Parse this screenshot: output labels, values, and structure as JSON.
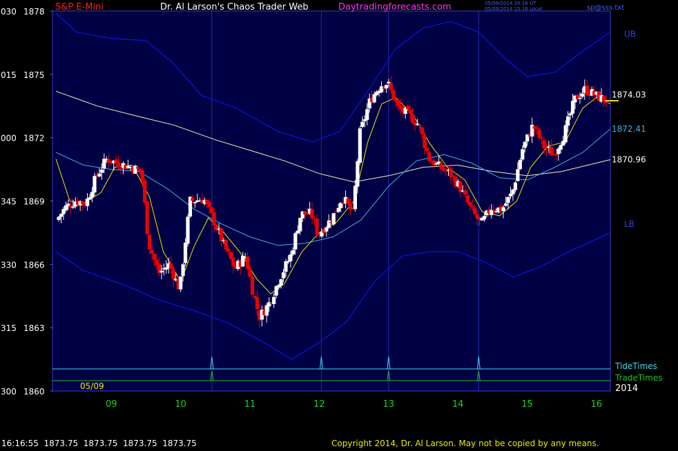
{
  "header": {
    "instrument": "S&P E-Mini",
    "author": "Dr. Al Larson's Chaos Trader Web",
    "website": "Daytradingforecasts.com",
    "utc_time": "05/09/2014 20:16 UT",
    "local_time": "05/09/2014 15:16 Local",
    "file": "sp@sss.txt"
  },
  "footer": {
    "quote": "16:16:55  1873.75  1873.75  1873.75  1873.75",
    "copyright": "Copyright 2014, Dr. Al Larson. May not be copied by any means."
  },
  "colors": {
    "background": "#000000",
    "plot_bg": "#000044",
    "up_bar": "#ffffff",
    "down_bar": "#ee0000",
    "envelope": "#0a14d6",
    "slow_ma": "#f2f2c0",
    "mid_ma": "#40b0ee",
    "fast_ma": "#f0e800",
    "tide_line": "#40d8f0",
    "trade_line": "#20c020",
    "gridline": "#1e2eb0",
    "header_red": "#ff2020",
    "header_magenta": "#ff30ff",
    "time_labels": "#20d020"
  },
  "chart_data": {
    "type": "candlestick",
    "date": "05/09",
    "year": "2014",
    "x_labels": [
      "09",
      "10",
      "11",
      "12",
      "13",
      "14",
      "15",
      "16"
    ],
    "x_range": [
      8.15,
      16.2
    ],
    "ylim": [
      1860,
      1878
    ],
    "y_ticks": [
      {
        "value": 1878,
        "label": "1878",
        "alt": "030"
      },
      {
        "value": 1875,
        "label": "1875",
        "alt": "015"
      },
      {
        "value": 1872,
        "label": "1872",
        "alt": "000"
      },
      {
        "value": 1869,
        "label": "1869",
        "alt": "345"
      },
      {
        "value": 1866,
        "label": "1866",
        "alt": "330"
      },
      {
        "value": 1863,
        "label": "1863",
        "alt": "315"
      },
      {
        "value": 1860,
        "label": "1860",
        "alt": "300"
      }
    ],
    "right_labels": [
      {
        "text": "UB",
        "value": 1876.9
      },
      {
        "text": "1874.03",
        "value": 1874.03
      },
      {
        "text": "1872.41",
        "value": 1872.41
      },
      {
        "text": "1870.96",
        "value": 1870.96
      },
      {
        "text": "LB",
        "value": 1867.9
      }
    ],
    "last_price": 1873.75,
    "vertical_lines": [
      10.45,
      12.03,
      13.0,
      14.3
    ],
    "tide_times": [
      10.45,
      12.03,
      13.0,
      14.3
    ],
    "trade_times": [
      10.45,
      13.0,
      14.3
    ],
    "legend": [
      "TideTimes",
      "TradeTimes"
    ],
    "price_path": [
      [
        8.2,
        1868.0
      ],
      [
        8.35,
        1868.7
      ],
      [
        8.5,
        1869.0
      ],
      [
        8.65,
        1868.9
      ],
      [
        8.8,
        1870.2
      ],
      [
        8.95,
        1871.0
      ],
      [
        9.1,
        1870.8
      ],
      [
        9.3,
        1870.6
      ],
      [
        9.45,
        1870.4
      ],
      [
        9.55,
        1867.0
      ],
      [
        9.7,
        1865.6
      ],
      [
        9.85,
        1866.0
      ],
      [
        10.0,
        1864.8
      ],
      [
        10.15,
        1869.0
      ],
      [
        10.35,
        1869.1
      ],
      [
        10.5,
        1868.0
      ],
      [
        10.65,
        1866.8
      ],
      [
        10.8,
        1865.8
      ],
      [
        10.95,
        1866.4
      ],
      [
        11.05,
        1864.8
      ],
      [
        11.15,
        1863.5
      ],
      [
        11.3,
        1864.2
      ],
      [
        11.45,
        1865.4
      ],
      [
        11.6,
        1866.4
      ],
      [
        11.75,
        1868.4
      ],
      [
        11.9,
        1868.4
      ],
      [
        12.0,
        1867.4
      ],
      [
        12.2,
        1868.2
      ],
      [
        12.35,
        1869.2
      ],
      [
        12.5,
        1868.4
      ],
      [
        12.6,
        1872.2
      ],
      [
        12.75,
        1873.8
      ],
      [
        12.9,
        1874.5
      ],
      [
        13.0,
        1874.6
      ],
      [
        13.15,
        1873.4
      ],
      [
        13.3,
        1873.1
      ],
      [
        13.45,
        1872.6
      ],
      [
        13.6,
        1871.0
      ],
      [
        13.75,
        1870.6
      ],
      [
        13.9,
        1870.3
      ],
      [
        14.05,
        1869.6
      ],
      [
        14.2,
        1868.6
      ],
      [
        14.35,
        1867.9
      ],
      [
        14.5,
        1868.7
      ],
      [
        14.65,
        1868.6
      ],
      [
        14.8,
        1869.4
      ],
      [
        14.95,
        1871.5
      ],
      [
        15.1,
        1872.6
      ],
      [
        15.25,
        1871.6
      ],
      [
        15.4,
        1871.2
      ],
      [
        15.55,
        1872.2
      ],
      [
        15.7,
        1873.8
      ],
      [
        15.85,
        1874.3
      ],
      [
        16.0,
        1874.0
      ],
      [
        16.15,
        1873.75
      ]
    ],
    "upper_band": [
      [
        8.2,
        1877.9
      ],
      [
        8.5,
        1877.0
      ],
      [
        9.0,
        1876.7
      ],
      [
        9.5,
        1876.6
      ],
      [
        9.9,
        1875.5
      ],
      [
        10.3,
        1874.0
      ],
      [
        10.8,
        1873.4
      ],
      [
        11.4,
        1872.3
      ],
      [
        11.9,
        1871.8
      ],
      [
        12.3,
        1872.3
      ],
      [
        12.7,
        1874.2
      ],
      [
        13.1,
        1876.2
      ],
      [
        13.5,
        1877.2
      ],
      [
        13.9,
        1877.5
      ],
      [
        14.3,
        1877.0
      ],
      [
        14.7,
        1875.7
      ],
      [
        15.0,
        1874.9
      ],
      [
        15.4,
        1875.1
      ],
      [
        15.8,
        1876.1
      ],
      [
        16.2,
        1877.0
      ]
    ],
    "lower_band": [
      [
        8.2,
        1866.6
      ],
      [
        8.6,
        1865.7
      ],
      [
        9.2,
        1865.0
      ],
      [
        9.7,
        1864.3
      ],
      [
        10.2,
        1863.8
      ],
      [
        10.7,
        1863.2
      ],
      [
        11.2,
        1862.3
      ],
      [
        11.6,
        1861.5
      ],
      [
        12.0,
        1862.3
      ],
      [
        12.4,
        1863.3
      ],
      [
        12.8,
        1865.2
      ],
      [
        13.2,
        1866.4
      ],
      [
        13.6,
        1866.6
      ],
      [
        14.0,
        1866.6
      ],
      [
        14.4,
        1866.1
      ],
      [
        14.8,
        1865.4
      ],
      [
        15.2,
        1865.9
      ],
      [
        15.6,
        1866.6
      ],
      [
        16.2,
        1867.5
      ]
    ],
    "slow_ma": [
      [
        8.2,
        1874.2
      ],
      [
        8.8,
        1873.5
      ],
      [
        9.4,
        1873.0
      ],
      [
        9.9,
        1872.6
      ],
      [
        10.5,
        1871.9
      ],
      [
        11.0,
        1871.4
      ],
      [
        11.5,
        1870.9
      ],
      [
        12.0,
        1870.3
      ],
      [
        12.5,
        1869.9
      ],
      [
        13.0,
        1870.2
      ],
      [
        13.5,
        1870.6
      ],
      [
        14.0,
        1870.7
      ],
      [
        14.5,
        1870.4
      ],
      [
        15.0,
        1870.2
      ],
      [
        15.5,
        1870.4
      ],
      [
        16.2,
        1870.96
      ]
    ],
    "mid_ma": [
      [
        8.2,
        1871.3
      ],
      [
        8.6,
        1870.7
      ],
      [
        9.0,
        1870.5
      ],
      [
        9.4,
        1870.4
      ],
      [
        9.8,
        1869.6
      ],
      [
        10.2,
        1868.6
      ],
      [
        10.6,
        1867.9
      ],
      [
        11.0,
        1867.3
      ],
      [
        11.4,
        1866.9
      ],
      [
        11.8,
        1867.0
      ],
      [
        12.2,
        1867.3
      ],
      [
        12.6,
        1868.1
      ],
      [
        13.0,
        1869.7
      ],
      [
        13.4,
        1870.9
      ],
      [
        13.8,
        1871.2
      ],
      [
        14.2,
        1870.8
      ],
      [
        14.6,
        1870.1
      ],
      [
        15.0,
        1870.0
      ],
      [
        15.4,
        1870.6
      ],
      [
        15.8,
        1871.3
      ],
      [
        16.2,
        1872.41
      ]
    ],
    "fast_ma": [
      [
        8.2,
        1871.0
      ],
      [
        8.4,
        1869.0
      ],
      [
        8.6,
        1868.9
      ],
      [
        8.85,
        1869.4
      ],
      [
        9.05,
        1870.6
      ],
      [
        9.3,
        1870.7
      ],
      [
        9.55,
        1869.2
      ],
      [
        9.75,
        1866.6
      ],
      [
        10.0,
        1865.2
      ],
      [
        10.2,
        1866.9
      ],
      [
        10.4,
        1868.2
      ],
      [
        10.6,
        1867.6
      ],
      [
        10.85,
        1866.6
      ],
      [
        11.1,
        1865.3
      ],
      [
        11.3,
        1864.6
      ],
      [
        11.5,
        1865.1
      ],
      [
        11.75,
        1866.6
      ],
      [
        12.0,
        1867.5
      ],
      [
        12.25,
        1868.0
      ],
      [
        12.5,
        1869.0
      ],
      [
        12.7,
        1871.8
      ],
      [
        12.9,
        1873.6
      ],
      [
        13.1,
        1873.9
      ],
      [
        13.35,
        1873.1
      ],
      [
        13.6,
        1871.7
      ],
      [
        13.85,
        1870.6
      ],
      [
        14.1,
        1870.0
      ],
      [
        14.35,
        1868.5
      ],
      [
        14.6,
        1868.3
      ],
      [
        14.85,
        1869.0
      ],
      [
        15.05,
        1870.6
      ],
      [
        15.3,
        1871.6
      ],
      [
        15.55,
        1871.8
      ],
      [
        15.8,
        1873.4
      ],
      [
        16.0,
        1873.9
      ],
      [
        16.2,
        1873.6
      ]
    ]
  }
}
